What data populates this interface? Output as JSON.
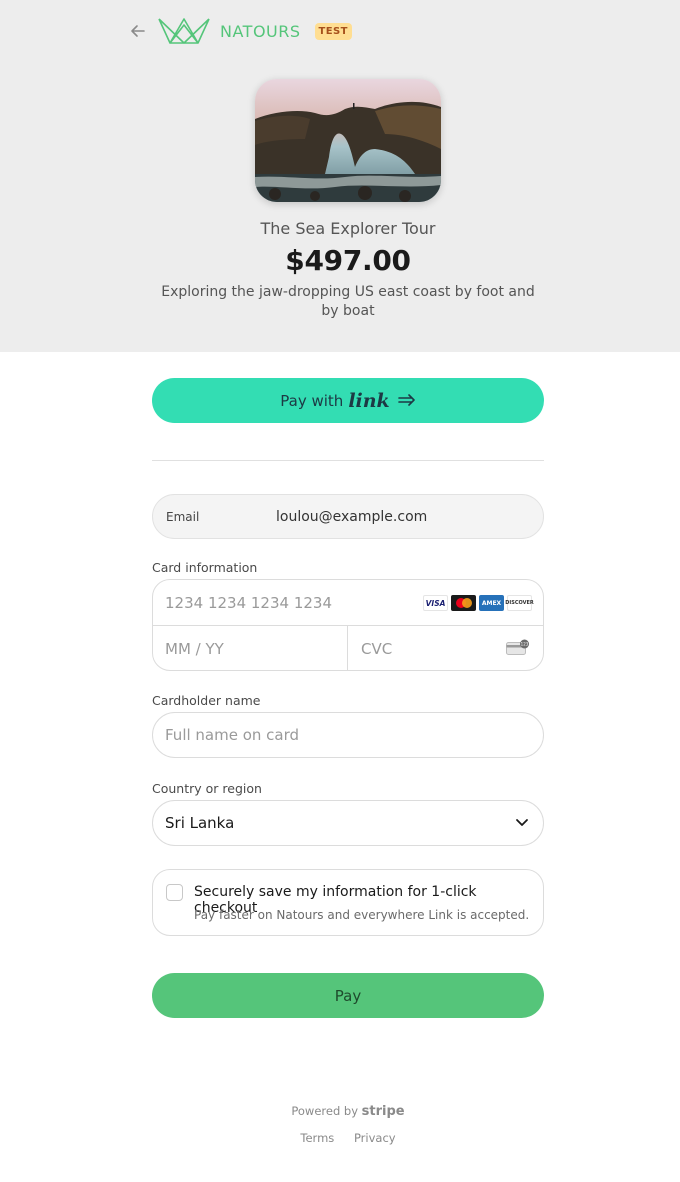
{
  "header": {
    "brand": "NATOURS",
    "badge": "TEST",
    "back_icon": "back-arrow-icon",
    "logo_icon": "crown-logo-icon",
    "brand_color": "#55c57a"
  },
  "product": {
    "name": "The Sea Explorer Tour",
    "price": "$497.00",
    "description": "Exploring the jaw-dropping US east coast by foot and by boat"
  },
  "link_button": {
    "label": "Pay with",
    "brand": "link",
    "icon": "arrow-right-icon",
    "color": "#33ddb3"
  },
  "email": {
    "label": "Email",
    "value": "loulou@example.com"
  },
  "card": {
    "label": "Card information",
    "number_placeholder": "1234 1234 1234 1234",
    "expiry_placeholder": "MM / YY",
    "cvc_placeholder": "CVC",
    "brands": [
      "VISA",
      "mastercard",
      "AMEX",
      "DISCOVER"
    ]
  },
  "cardholder": {
    "label": "Cardholder name",
    "placeholder": "Full name on card"
  },
  "country": {
    "label": "Country or region",
    "value": "Sri Lanka"
  },
  "save_info": {
    "title": "Securely save my information for 1-click checkout",
    "subtitle": "Pay faster on Natours and everywhere Link is accepted."
  },
  "pay_button": {
    "label": "Pay",
    "color": "#55c57a"
  },
  "footer": {
    "powered": "Powered by",
    "stripe": "stripe",
    "terms": "Terms",
    "privacy": "Privacy"
  }
}
